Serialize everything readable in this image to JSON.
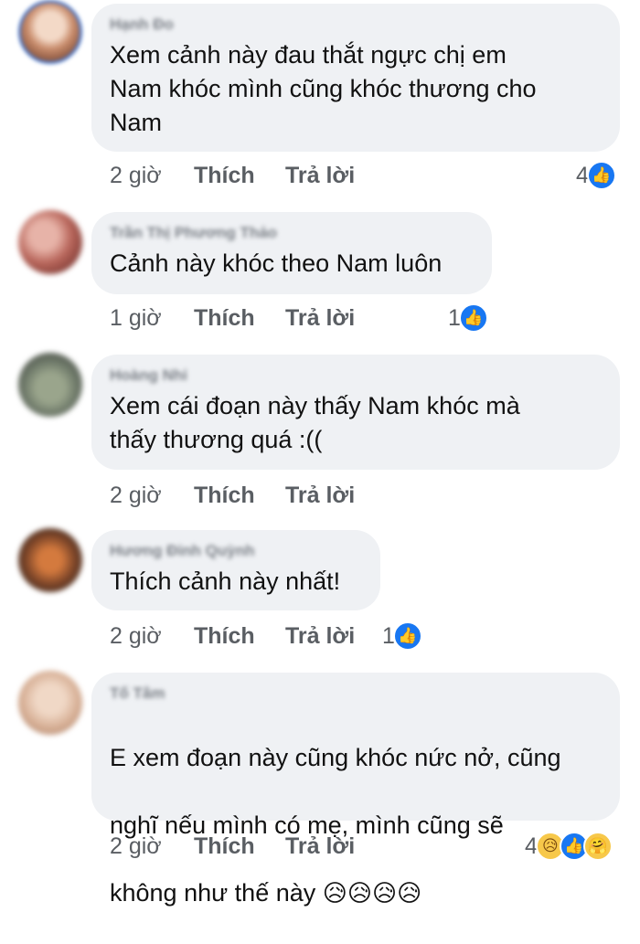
{
  "comments": [
    {
      "author": "Hạnh Đo",
      "text": "Xem cảnh này đau thắt ngực chị em\nNam khóc mình cũng khóc thương cho\nNam",
      "time": "2 giờ",
      "like": "Thích",
      "reply": "Trả lời",
      "reaction_count": "4",
      "reactions": [
        "like-icon"
      ]
    },
    {
      "author": "Trần Thị Phương Thảo",
      "text": "Cảnh này khóc theo Nam luôn",
      "time": "1 giờ",
      "like": "Thích",
      "reply": "Trả lời",
      "reaction_count": "1",
      "reactions": [
        "like-icon"
      ]
    },
    {
      "author": "Hoàng Nhi",
      "text": "Xem cái đoạn này thấy Nam khóc mà\nthấy thương quá :((",
      "time": "2 giờ",
      "like": "Thích",
      "reply": "Trả lời",
      "reaction_count": "",
      "reactions": []
    },
    {
      "author": "Hương Đinh Quỳnh",
      "text": "Thích cảnh này nhất!",
      "time": "2 giờ",
      "like": "Thích",
      "reply": "Trả lời",
      "reaction_count": "1",
      "reactions": [
        "like-icon"
      ]
    },
    {
      "author": "Tố Tâm",
      "text_line1": "E xem đoạn này cũng khóc nức nở, cũng",
      "text_line2": "nghĩ nếu mình có mẹ, mình cũng sẽ",
      "text_line3": "không như thế này",
      "emojis": "😥😥😥😥",
      "time": "2 giờ",
      "like": "Thích",
      "reply": "Trả lời",
      "reaction_count": "4",
      "reactions": [
        "sad-icon",
        "like-icon",
        "care-icon"
      ]
    }
  ],
  "colors": {
    "bubble": "#eff1f4",
    "like_blue": "#1877f2",
    "meta_gray": "#5a5e63"
  }
}
